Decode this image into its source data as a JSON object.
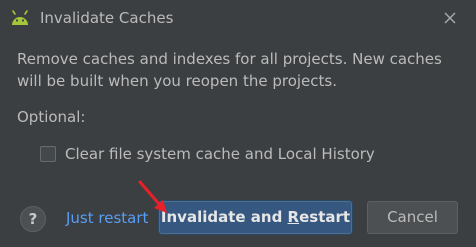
{
  "window": {
    "title": "Invalidate Caches",
    "app_icon": "android-icon",
    "close_icon": "close-icon"
  },
  "message": {
    "line1": "Remove caches and indexes for all projects. New caches",
    "line2": "will be built when you reopen the projects."
  },
  "optional_label": "Optional:",
  "options": {
    "clear_cache": {
      "label": "Clear file system cache and Local History",
      "checked": false
    }
  },
  "footer": {
    "help_label": "?",
    "just_restart_label": "Just restart",
    "primary_label_prefix": "Invalidate and ",
    "primary_label_mnemonic": "R",
    "primary_label_suffix": "estart",
    "cancel_label": "Cancel"
  },
  "annotation": {
    "arrow_color": "#e8202a",
    "arrow_icon": "red-arrow-icon"
  },
  "colors": {
    "background": "#3c3f41",
    "text": "#bbbbbb",
    "link": "#589df6",
    "primary_button": "#365880",
    "android_green": "#a4c639"
  }
}
